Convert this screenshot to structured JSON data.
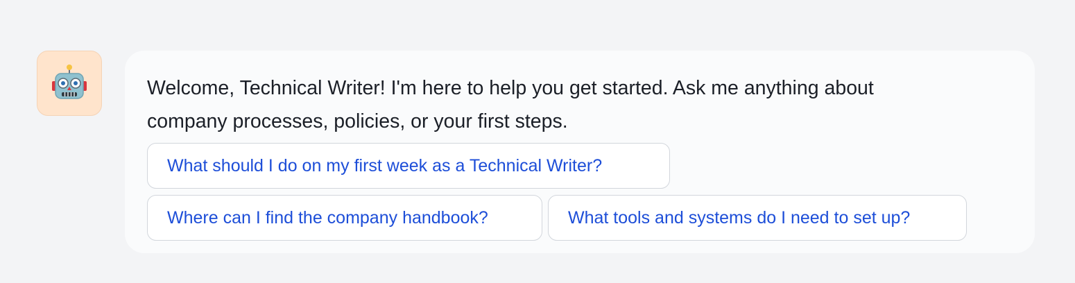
{
  "assistant": {
    "avatar_icon": "robot-icon",
    "avatar_bg": "#ffe4cc",
    "message": "Welcome, Technical Writer! I'm here to help you get started. Ask me anything about company processes, policies, or your first steps."
  },
  "suggestions": [
    "What should I do on my first week as a Technical Writer?",
    "Where can I find the company handbook?",
    "What tools and systems do I need to set up?"
  ],
  "colors": {
    "accent": "#1d4ed8",
    "text": "#1b1f27",
    "background": "#f3f4f6"
  }
}
